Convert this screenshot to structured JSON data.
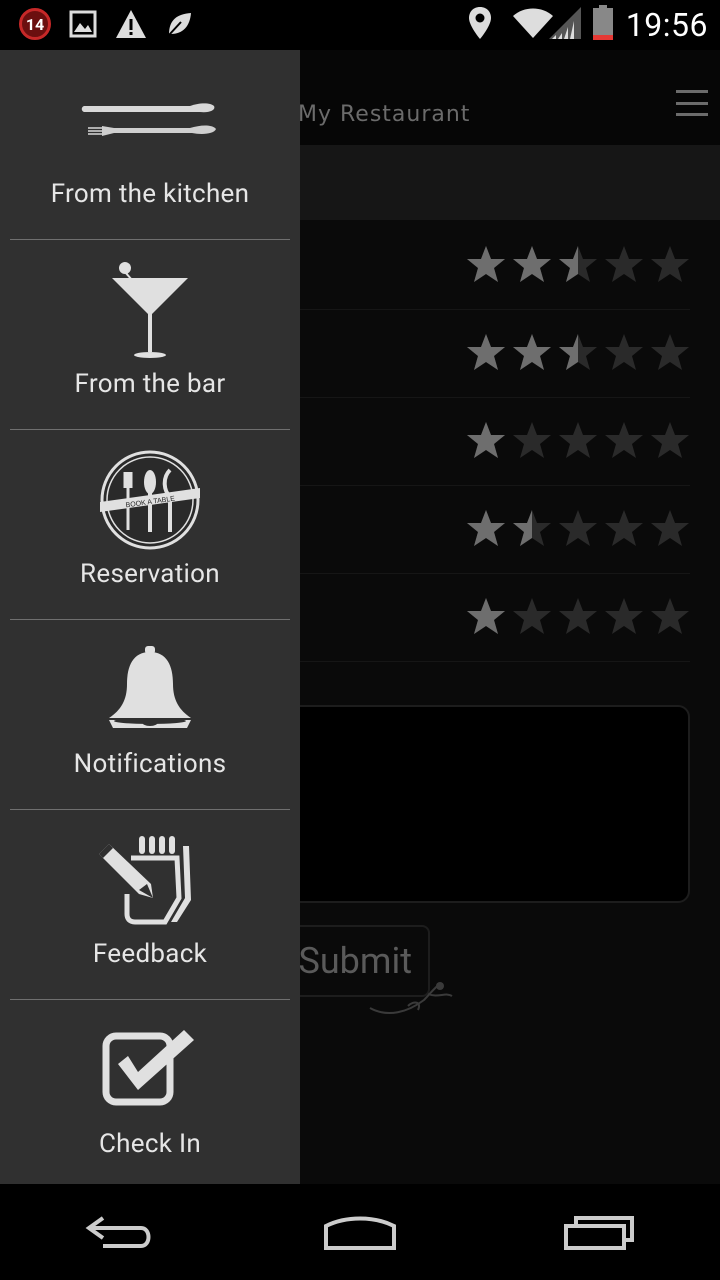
{
  "status_bar": {
    "notification_count": "14",
    "time": "19:56",
    "icons": [
      "notification-badge-icon",
      "image-icon",
      "warning-icon",
      "leaf-icon",
      "location-icon",
      "wifi-icon",
      "signal-icon",
      "battery-icon"
    ]
  },
  "app_bar": {
    "title": "My Restaurant"
  },
  "ratings": [
    {
      "value": 2.5,
      "max": 5
    },
    {
      "value": 2.5,
      "max": 5
    },
    {
      "value": 1,
      "max": 5
    },
    {
      "value": 1.5,
      "max": 5
    },
    {
      "value": 1,
      "max": 5
    }
  ],
  "form": {
    "submit_label": "Submit"
  },
  "drawer": {
    "items": [
      {
        "label": "From the kitchen",
        "icon": "cutlery-icon"
      },
      {
        "label": "From the bar",
        "icon": "cocktail-icon"
      },
      {
        "label": "Reservation",
        "icon": "book-a-table-icon",
        "icon_text": "BOOK A TABLE"
      },
      {
        "label": "Notifications",
        "icon": "bell-icon"
      },
      {
        "label": "Feedback",
        "icon": "hand-pencil-icon"
      },
      {
        "label": "Check In",
        "icon": "checkbox-icon"
      }
    ]
  },
  "colors": {
    "drawer_bg": "#303030",
    "star_filled": "#6e6e6e",
    "star_empty": "#2a2a2a",
    "notification_red": "#c62828"
  }
}
